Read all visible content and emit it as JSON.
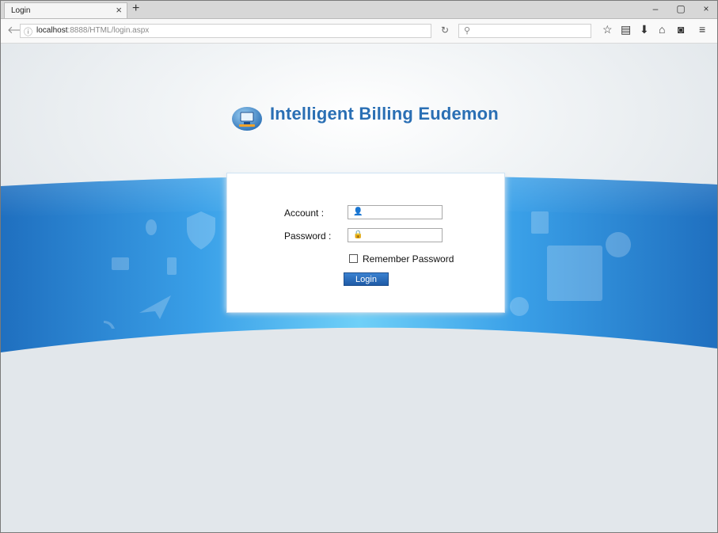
{
  "browser": {
    "tab_title": "Login",
    "tab_close": "×",
    "new_tab": "+",
    "window_controls": {
      "minimize": "–",
      "restore": "▢",
      "close": "×"
    },
    "url_host": "localhost",
    "url_rest": ":8888/HTML/login.aspx",
    "icons": [
      "back-arrow-icon",
      "info-icon",
      "reload-icon",
      "search-icon",
      "bookmark-star-icon",
      "reading-list-icon",
      "download-icon",
      "home-icon",
      "pocket-icon",
      "menu-icon"
    ]
  },
  "page": {
    "title": "Intelligent Billing Eudemon",
    "account_label": "Account :",
    "password_label": "Password :",
    "account_value": "",
    "password_value": "",
    "remember_label": "Remember Password",
    "remember_checked": false,
    "login_button": "Login"
  },
  "colors": {
    "brand": "#2a6fb4",
    "band": "#2b86d6",
    "button": "#2a6cc0"
  }
}
